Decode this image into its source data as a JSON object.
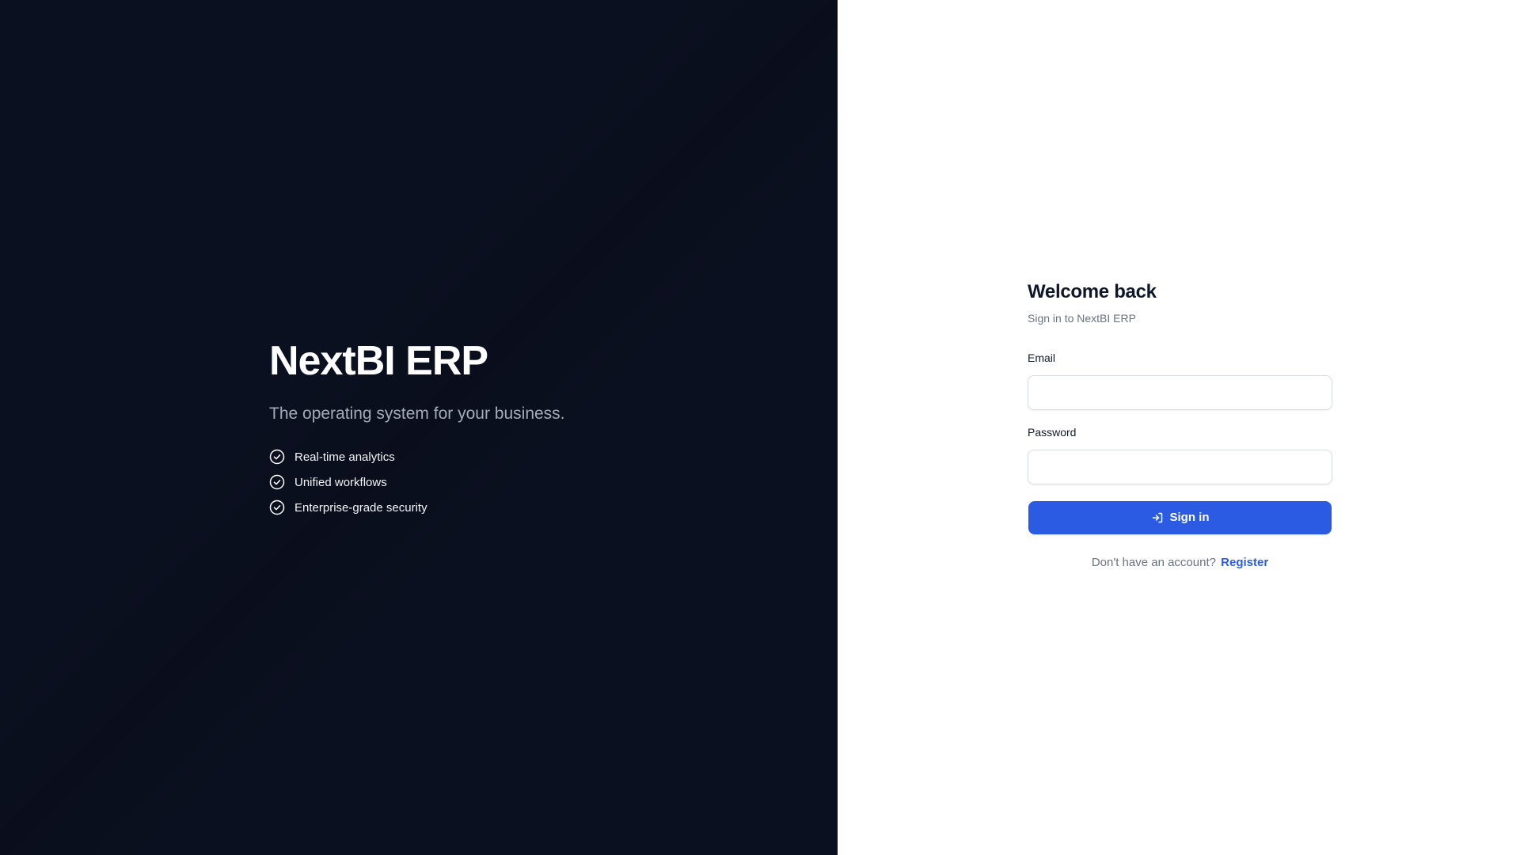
{
  "hero": {
    "title": "NextBI ERP",
    "tagline": "The operating system for your business.",
    "features": [
      {
        "label": "Real-time analytics",
        "icon": "check-circle-icon"
      },
      {
        "label": "Unified workflows",
        "icon": "check-circle-icon"
      },
      {
        "label": "Enterprise-grade security",
        "icon": "check-circle-icon"
      }
    ]
  },
  "login": {
    "title": "Welcome back",
    "subtitle": "Sign in to NextBI ERP",
    "email": {
      "label": "Email",
      "value": "",
      "placeholder": ""
    },
    "password": {
      "label": "Password",
      "value": "",
      "placeholder": ""
    },
    "submit_label": "Sign in",
    "submit_icon": "log-in-icon",
    "register_prompt": "Don't have an account?",
    "register_label": "Register"
  },
  "colors": {
    "hero_background": "#0b1020",
    "accent": "#2b5be3",
    "heading": "#0f172a",
    "muted_text": "#6b7280"
  }
}
